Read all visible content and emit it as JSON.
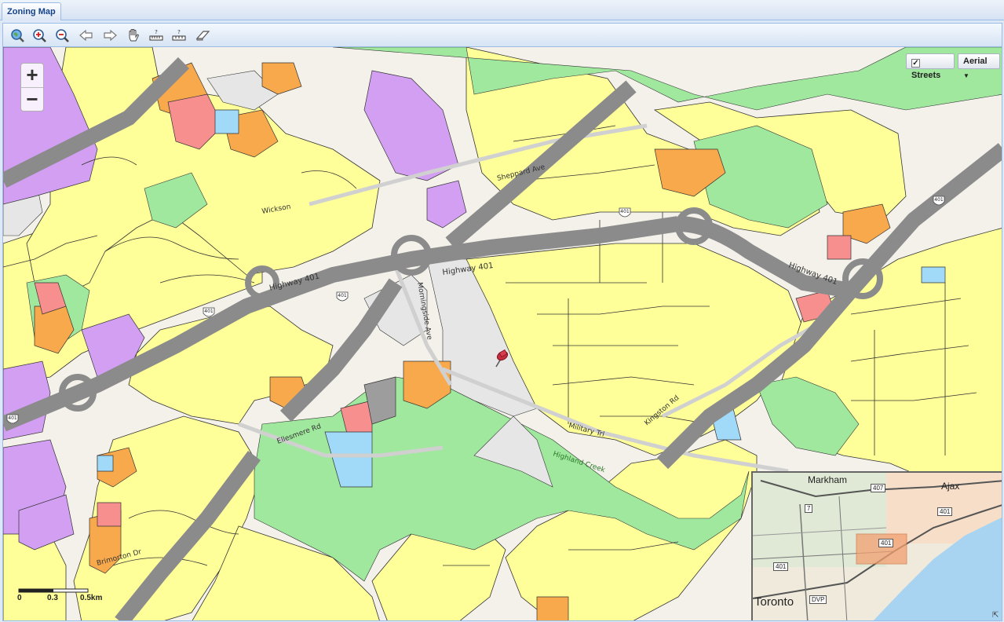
{
  "tabs": [
    {
      "label": "Zoning Map"
    }
  ],
  "toolbar": {
    "tools": [
      {
        "name": "full-extent-icon"
      },
      {
        "name": "zoom-in-icon"
      },
      {
        "name": "zoom-out-icon"
      },
      {
        "name": "back-arrow-icon"
      },
      {
        "name": "forward-arrow-icon"
      },
      {
        "name": "pan-hand-icon"
      },
      {
        "name": "measure-area-icon"
      },
      {
        "name": "measure-distance-icon"
      },
      {
        "name": "eraser-icon"
      }
    ]
  },
  "map": {
    "zoom_in_label": "+",
    "zoom_out_label": "−",
    "streets_label": "Streets",
    "streets_checked": true,
    "basemap_label": "Aerial",
    "scale": {
      "labels": [
        "0",
        "0.3",
        "0.5km"
      ]
    },
    "roads": [
      {
        "label": "Highway 401"
      },
      {
        "label": "Highway 401"
      },
      {
        "label": "Highway 401"
      },
      {
        "label": "Sheppard Ave"
      },
      {
        "label": "Wickson"
      },
      {
        "label": "Military Trl"
      },
      {
        "label": "Ellesmere Rd"
      },
      {
        "label": "Morningside Ave"
      },
      {
        "label": "Kingston Rd"
      },
      {
        "label": "Highland Creek"
      },
      {
        "label": "Brimorton Dr"
      }
    ],
    "shields": [
      "401",
      "401",
      "401",
      "401",
      "401"
    ],
    "colors": {
      "residential": "#ffff99",
      "park": "#9ee89c",
      "commercial": "#f9a94b",
      "institutional": "#cf9cf0",
      "industrial": "#f78f8f",
      "utility": "#a0d8f7",
      "highway": "#8f8f8f",
      "open": "#e4e4e4"
    }
  },
  "overview": {
    "labels": [
      "Markham",
      "Ajax",
      "Toronto"
    ],
    "shields": [
      "407",
      "7",
      "401",
      "401",
      "401",
      "DVP"
    ]
  }
}
